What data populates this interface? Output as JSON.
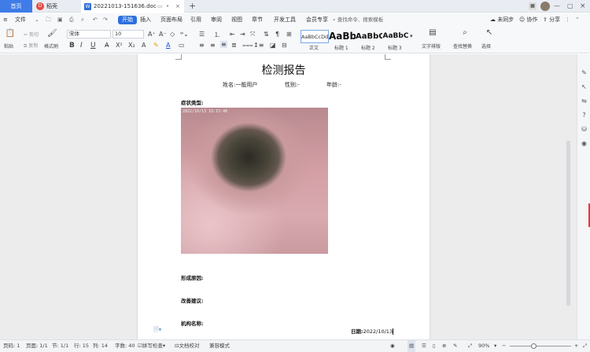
{
  "tabs": {
    "home": "首页",
    "shell": "稻壳",
    "doc": "20221013-151636.doc"
  },
  "menu": {
    "file": "文件",
    "items": [
      "开始",
      "插入",
      "页面布局",
      "引用",
      "审阅",
      "视图",
      "章节",
      "开发工具",
      "会员专享"
    ],
    "search_placeholder": "查找命令、搜索模板",
    "right": [
      "未同步",
      "协作",
      "分享"
    ]
  },
  "ribbon": {
    "paste": "粘贴",
    "cut": "剪切",
    "copy": "复制",
    "format_painter": "格式刷",
    "font_name": "宋体",
    "font_size": "10",
    "styles": [
      {
        "sample": "AaBbCcDd",
        "name": "正文"
      },
      {
        "sample": "AaBb",
        "name": "标题 1"
      },
      {
        "sample": "AaBbC",
        "name": "标题 2"
      },
      {
        "sample": "AaBbC",
        "name": "标题 3"
      }
    ],
    "text_layout": "文字排版",
    "find_replace": "查找替换",
    "select": "选择"
  },
  "document": {
    "title": "检测报告",
    "name_field": "姓名:一般用户",
    "gender_field": "性别:-",
    "age_field": "年龄:-",
    "symptom_label": "症状类型:",
    "photo_timestamp": "2022/10/13 15:15:48",
    "cause_label": "形成原因:",
    "advice_label": "改善建议:",
    "org_label": "机构名称:",
    "date_label": "日期:",
    "date_value": "2022/10/13"
  },
  "status": {
    "page": "页码: 1",
    "pages": "页面: 1/1",
    "section": "节: 1/1",
    "row": "行: 15",
    "col": "列: 14",
    "words": "字数: 40",
    "spell": "拼写检查",
    "doc_check": "文档校对",
    "compat": "兼容模式",
    "zoom": "90%"
  },
  "colors": {
    "accent": "#2d6fe0",
    "home_tab": "#3f7ce8"
  }
}
